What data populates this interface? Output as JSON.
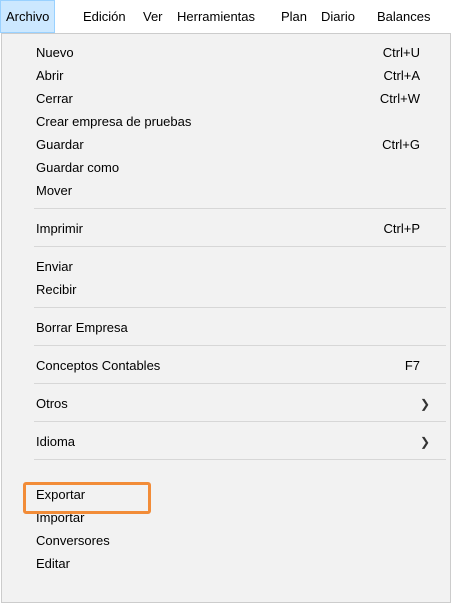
{
  "menubar": {
    "items": [
      "Archivo",
      "Edición",
      "Ver",
      "Herramientas",
      "Plan",
      "Diario",
      "Balances"
    ]
  },
  "menu": {
    "items": [
      {
        "label": "Nuevo",
        "shortcut": "Ctrl+U"
      },
      {
        "label": "Abrir",
        "shortcut": "Ctrl+A"
      },
      {
        "label": "Cerrar",
        "shortcut": "Ctrl+W"
      },
      {
        "label": "Crear empresa de pruebas",
        "shortcut": ""
      },
      {
        "label": "Guardar",
        "shortcut": "Ctrl+G"
      },
      {
        "label": "Guardar como",
        "shortcut": ""
      },
      {
        "label": "Mover",
        "shortcut": ""
      },
      {
        "label": "Imprimir",
        "shortcut": "Ctrl+P"
      },
      {
        "label": "Enviar",
        "shortcut": ""
      },
      {
        "label": "Recibir",
        "shortcut": ""
      },
      {
        "label": "Borrar Empresa",
        "shortcut": ""
      },
      {
        "label": "Conceptos Contables",
        "shortcut": "F7"
      },
      {
        "label": "Otros",
        "shortcut": ""
      },
      {
        "label": "Idioma",
        "shortcut": ""
      },
      {
        "label": "Exportar",
        "shortcut": ""
      },
      {
        "label": "Importar",
        "shortcut": ""
      },
      {
        "label": "Conversores",
        "shortcut": ""
      },
      {
        "label": "Editar",
        "shortcut": ""
      }
    ],
    "submenu_icon": "chevron-right-icon",
    "highlight_color": "#f28c38"
  }
}
